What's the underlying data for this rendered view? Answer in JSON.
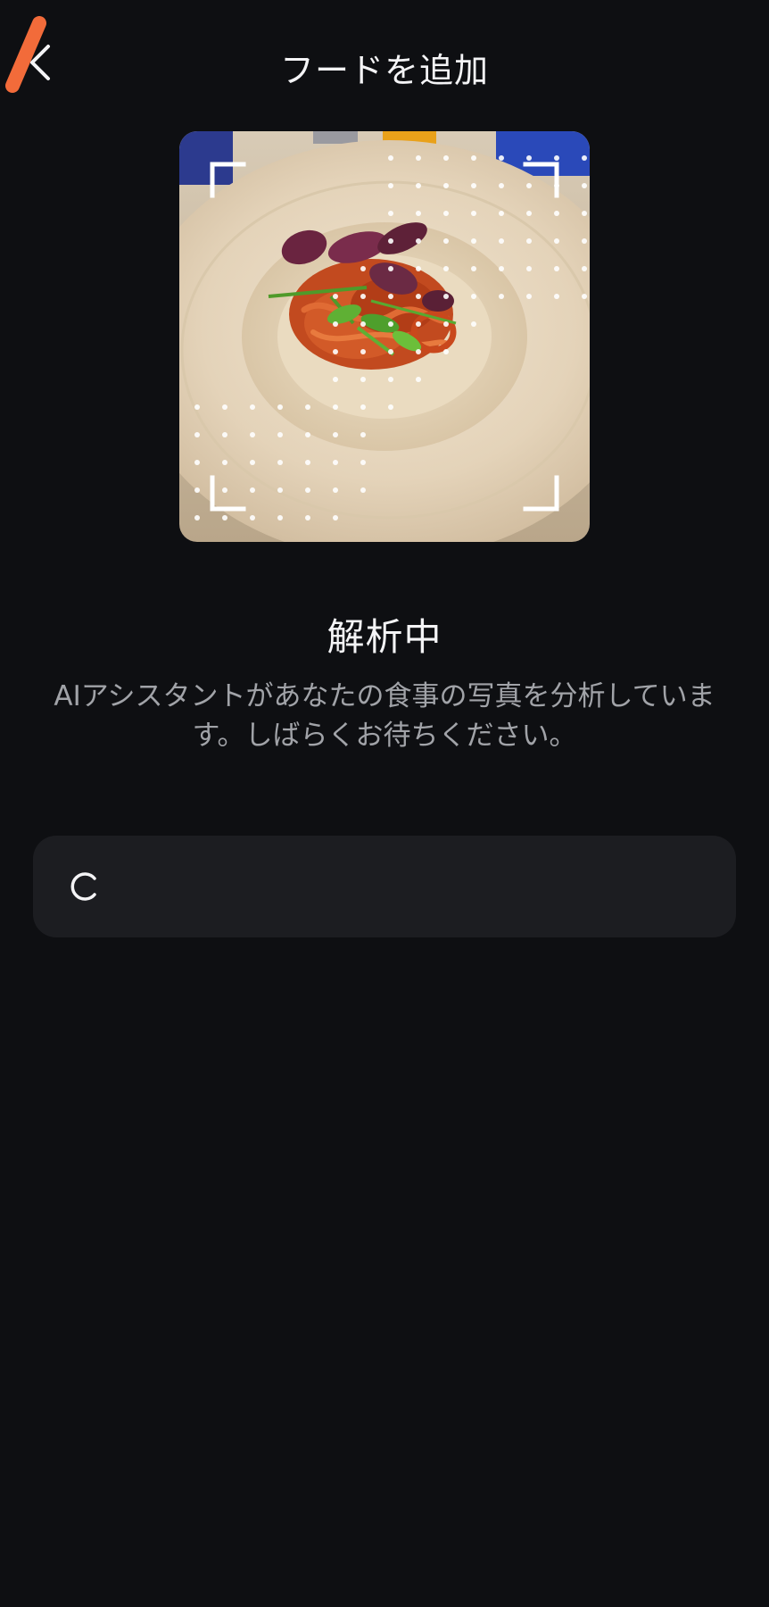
{
  "header": {
    "title": "フードを追加",
    "back_icon": "chevron-left-icon",
    "accent_color": "#f26b3a"
  },
  "photo": {
    "subject": "pasta-dish-photo",
    "scan_overlay": "scan-frame-with-dots"
  },
  "analysis": {
    "status_title": "解析中",
    "description": "AIアシスタントがあなたの食事の写真を分析しています。しばらくお待ちください。"
  },
  "result_card": {
    "icon": "loading-spinner-icon"
  },
  "colors": {
    "background": "#0e0f12",
    "card": "#1c1d21",
    "text_primary": "#f4f4f6",
    "text_secondary": "#a1a3a8"
  }
}
